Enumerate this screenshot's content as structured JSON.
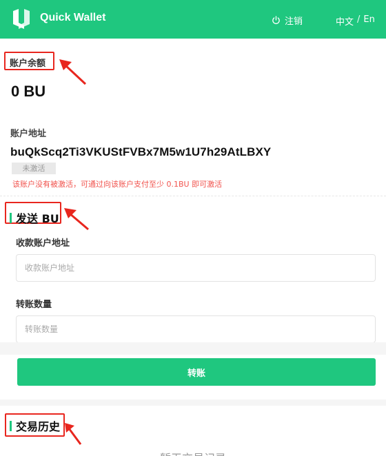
{
  "header": {
    "app_title": "Quick Wallet",
    "logout_label": "注销",
    "lang_zh": "中文",
    "lang_sep": "/",
    "lang_en": "En"
  },
  "account": {
    "balance_label": "账户余额",
    "balance_value": "0 BU",
    "address_label": "账户地址",
    "address_value": "buQkScq2Ti3VKUStFVBx7M5w1U7h29AtLBXY",
    "status_badge": "未激活",
    "inactive_warning": "该账户没有被激活，可通过向该账户支付至少 0.1BU 即可激活"
  },
  "send": {
    "title": "发送 BU",
    "recipient_label": "收款账户地址",
    "recipient_placeholder": "收款账户地址",
    "recipient_value": "",
    "amount_label": "转账数量",
    "amount_placeholder": "转账数量",
    "amount_value": "",
    "submit_label": "转账"
  },
  "history": {
    "title": "交易历史",
    "empty_text": "暂无交易记录"
  },
  "colors": {
    "brand": "#1fc77f",
    "annotation_red": "#e8261e",
    "warning_red": "#f1534d"
  }
}
